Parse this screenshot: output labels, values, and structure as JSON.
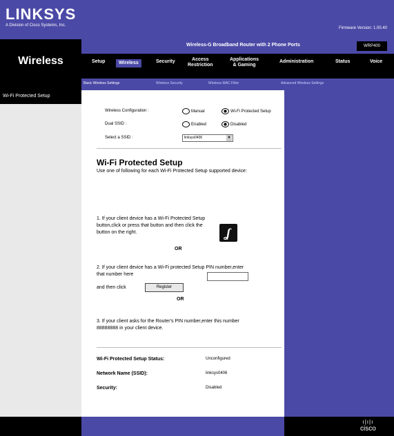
{
  "brand": {
    "logo": "LINKSYS",
    "logo_tagline": "A Division of Cisco Systems, Inc.",
    "firmware": "Firmware Version: 1.00.40"
  },
  "product": {
    "name": "Wireless-G Broadband Router with 2 Phone Ports",
    "model": "WRP400"
  },
  "section_title": "Wireless",
  "nav": {
    "items": [
      {
        "label": "Setup"
      },
      {
        "label": "Wireless",
        "active": true
      },
      {
        "label": "Security"
      },
      {
        "label": "Access\nRestriction"
      },
      {
        "label": "Applications\n& Gaming"
      },
      {
        "label": "Administration"
      },
      {
        "label": "Status"
      },
      {
        "label": "Voice"
      }
    ],
    "subitems": [
      {
        "label": "Basic Wireless Settings",
        "active": true
      },
      {
        "label": "Wireless Security"
      },
      {
        "label": "Wireless MAC Filter"
      },
      {
        "label": "Advanced Wireless Settings"
      }
    ]
  },
  "sidebar": {
    "subtitle": "Wi-Fi Protected Setup"
  },
  "form": {
    "wireless_config_label": "Wireless Configuration :",
    "manual_label": "Manual",
    "wps_label": "Wi-Fi Protected Setup",
    "dual_ssid_label": "Dual SSID :",
    "enabled_label": "Enabled",
    "disabled_label": "Disabled",
    "select_ssid_label": "Select a SSID :",
    "select_ssid_value": "linksys0406"
  },
  "wps": {
    "heading": "Wi-Fi Protected Setup",
    "intro": "Use one of following for each Wi-Fi Protected Setup supported device:",
    "step1": "1. If your client device has a Wi-Fi Protected Setup button,click or press that button and then click the button on the right.",
    "or1": "OR",
    "step2a": "2. If your client device has a Wi-Fi protected Setup PIN number,enter that number here",
    "step2b": "and then click",
    "register_button": "Register",
    "or2": "OR",
    "step3": "3. If your client asks for the Router's PIN number,enter this number 88888888 in your client device."
  },
  "status": {
    "wps_status_label": "Wi-Fi Protected Setup Status:",
    "wps_status_value": "Unconfigured",
    "network_name_label": "Network Name (SSID):",
    "network_name_value": "linksys0406",
    "security_label": "Security:",
    "security_value": "Disabled"
  },
  "footer": {
    "cisco": "cisco"
  },
  "colors": {
    "brand_purple": "#4b49a6",
    "black": "#000000",
    "sidebar_gray": "#e9e9e9"
  }
}
